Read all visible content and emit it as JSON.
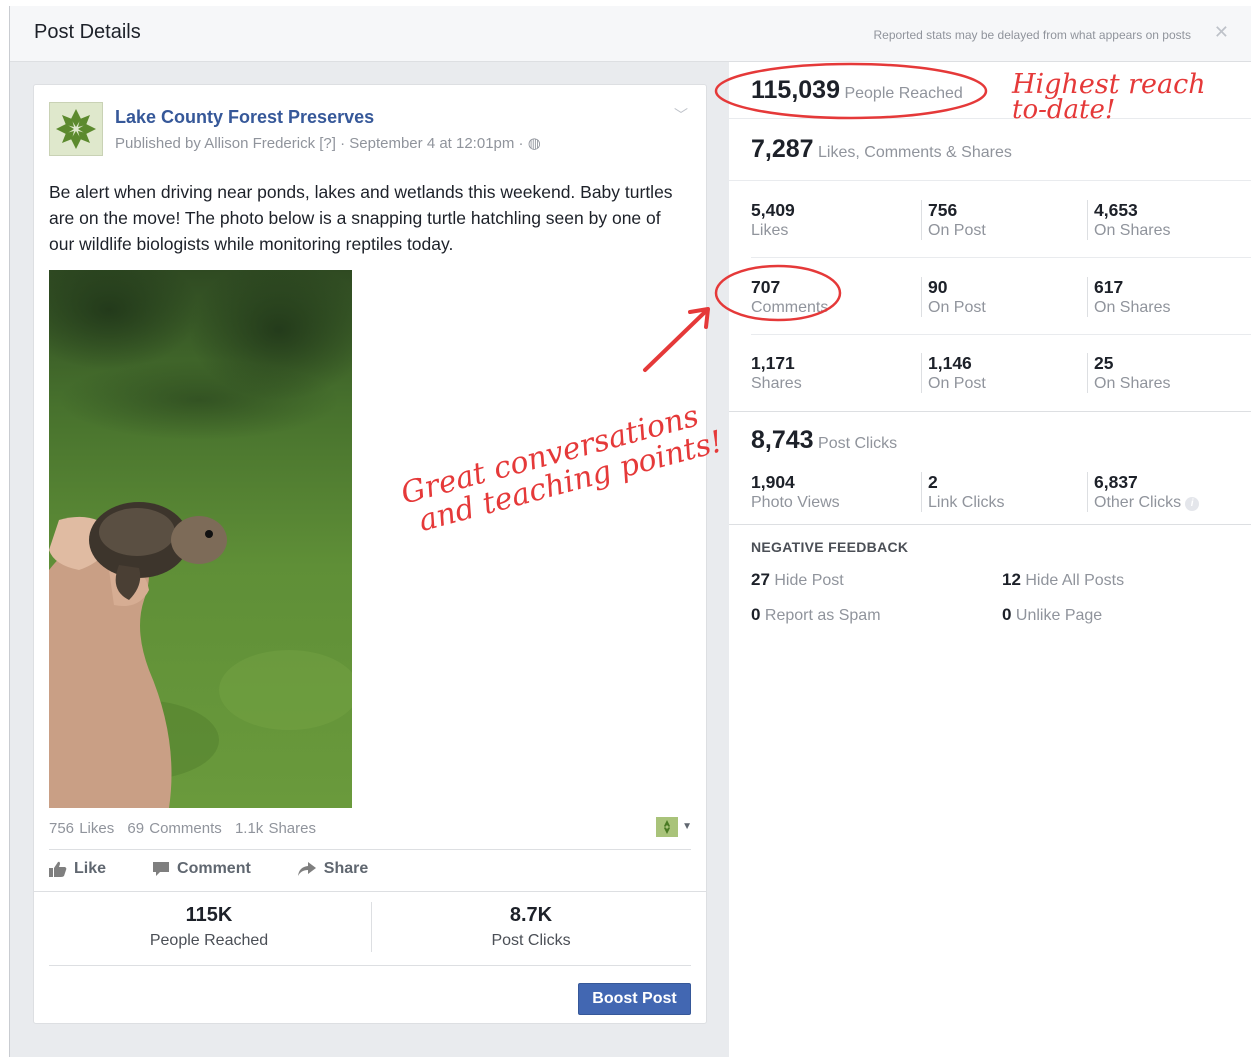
{
  "dialog": {
    "title": "Post Details",
    "note": "Reported stats may be delayed from what appears on posts",
    "close_glyph": "✕"
  },
  "post": {
    "page_name": "Lake County Forest Preserves",
    "meta": "Published by Allison Frederick [?] · September 4 at 12:01pm · ◍",
    "text": "Be alert when driving near ponds, lakes and wetlands this weekend. Baby turtles are on the move! The photo below is a snapping turtle hatchling seen by one of our wildlife biologists while monitoring reptiles today.",
    "counts": {
      "likes": "756 Likes",
      "comments": "69 Comments",
      "shares": "1.1k Shares"
    },
    "actions": {
      "like": "Like",
      "comment": "Comment",
      "share": "Share"
    },
    "summary": {
      "reached_value": "115K",
      "reached_label": "People Reached",
      "clicks_value": "8.7K",
      "clicks_label": "Post Clicks"
    },
    "boost_label": "Boost Post"
  },
  "stats": {
    "reach": {
      "value": "115,039",
      "label": "People Reached"
    },
    "engagement": {
      "value": "7,287",
      "label": "Likes, Comments & Shares"
    },
    "likes": [
      {
        "value": "5,409",
        "label": "Likes"
      },
      {
        "value": "756",
        "label": "On Post"
      },
      {
        "value": "4,653",
        "label": "On Shares"
      }
    ],
    "comments": [
      {
        "value": "707",
        "label": "Comments"
      },
      {
        "value": "90",
        "label": "On Post"
      },
      {
        "value": "617",
        "label": "On Shares"
      }
    ],
    "shares": [
      {
        "value": "1,171",
        "label": "Shares"
      },
      {
        "value": "1,146",
        "label": "On Post"
      },
      {
        "value": "25",
        "label": "On Shares"
      }
    ],
    "clicks": {
      "value": "8,743",
      "label": "Post Clicks"
    },
    "click_breakdown": [
      {
        "value": "1,904",
        "label": "Photo Views"
      },
      {
        "value": "2",
        "label": "Link Clicks"
      },
      {
        "value": "6,837",
        "label": "Other Clicks"
      }
    ],
    "negative": {
      "heading": "NEGATIVE FEEDBACK",
      "hide_post": {
        "value": "27",
        "label": "Hide Post"
      },
      "hide_all": {
        "value": "12",
        "label": "Hide All Posts"
      },
      "spam": {
        "value": "0",
        "label": "Report as Spam"
      },
      "unlike": {
        "value": "0",
        "label": "Unlike Page"
      }
    }
  },
  "annotations": {
    "reach_note_line1": "Highest reach",
    "reach_note_line2": "to-date!",
    "comments_note_line1": "Great conversations",
    "comments_note_line2": "and teaching points!",
    "color": "#e53939"
  }
}
